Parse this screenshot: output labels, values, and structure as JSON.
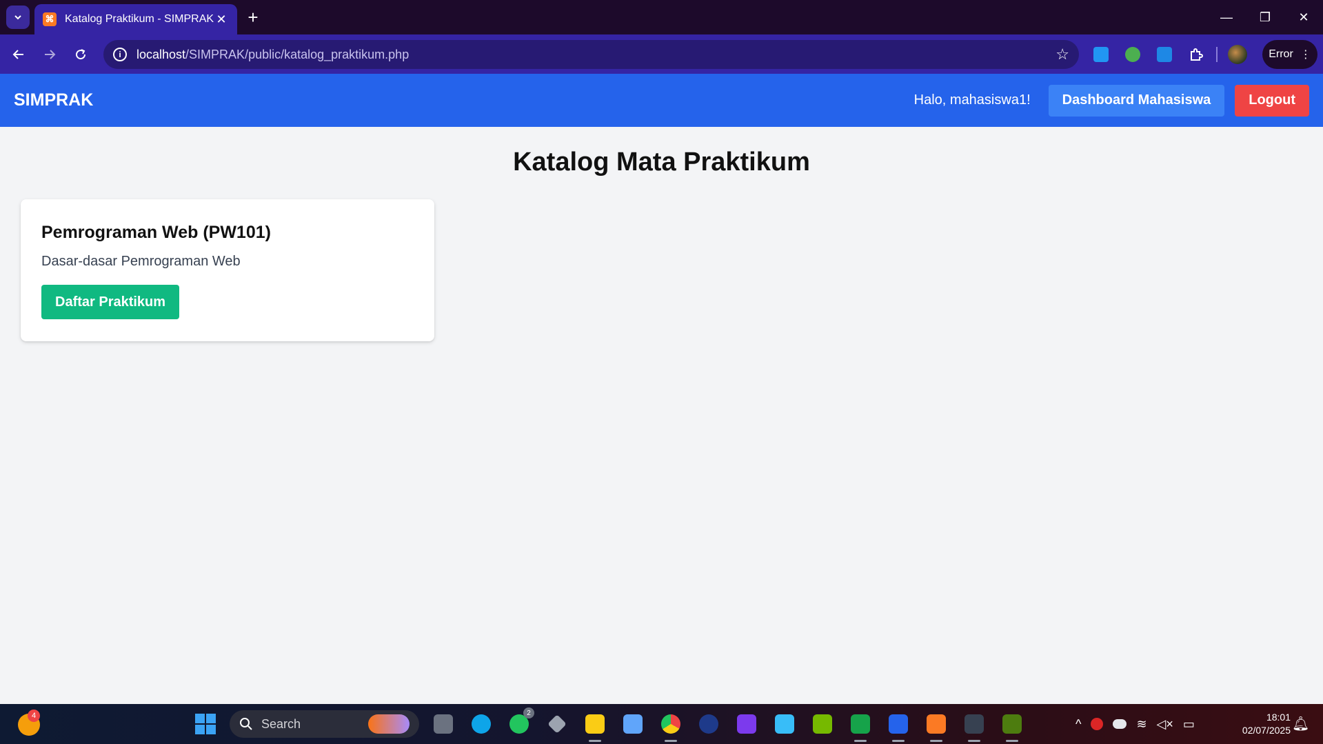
{
  "browser": {
    "tab_title": "Katalog Praktikum - SIMPRAK",
    "favicon_glyph": "⌘",
    "new_tab_glyph": "+",
    "close_glyph": "✕",
    "url_host": "localhost",
    "url_path": "/SIMPRAK/public/katalog_praktikum.php",
    "profile_label": "Error",
    "window_controls": [
      "—",
      "❐",
      "✕"
    ]
  },
  "navbar": {
    "brand": "SIMPRAK",
    "greeting": "Halo, mahasiswa1!",
    "dashboard_label": "Dashboard Mahasiswa",
    "logout_label": "Logout"
  },
  "main": {
    "title": "Katalog Mata Praktikum",
    "courses": [
      {
        "title": "Pemrograman Web (PW101)",
        "description": "Dasar-dasar Pemrograman Web",
        "action_label": "Daftar Praktikum"
      }
    ]
  },
  "taskbar": {
    "search_placeholder": "Search",
    "notification_count": "4",
    "whatsapp_badge": "2",
    "time": "18:01",
    "date": "02/07/2025"
  },
  "colors": {
    "navbar": "#2563eb",
    "dashboard_button": "#3b82f6",
    "logout_button": "#ef4444",
    "daftar_button": "#10b981",
    "page_background": "#f3f4f6",
    "browser_chrome": "#3524a4"
  }
}
